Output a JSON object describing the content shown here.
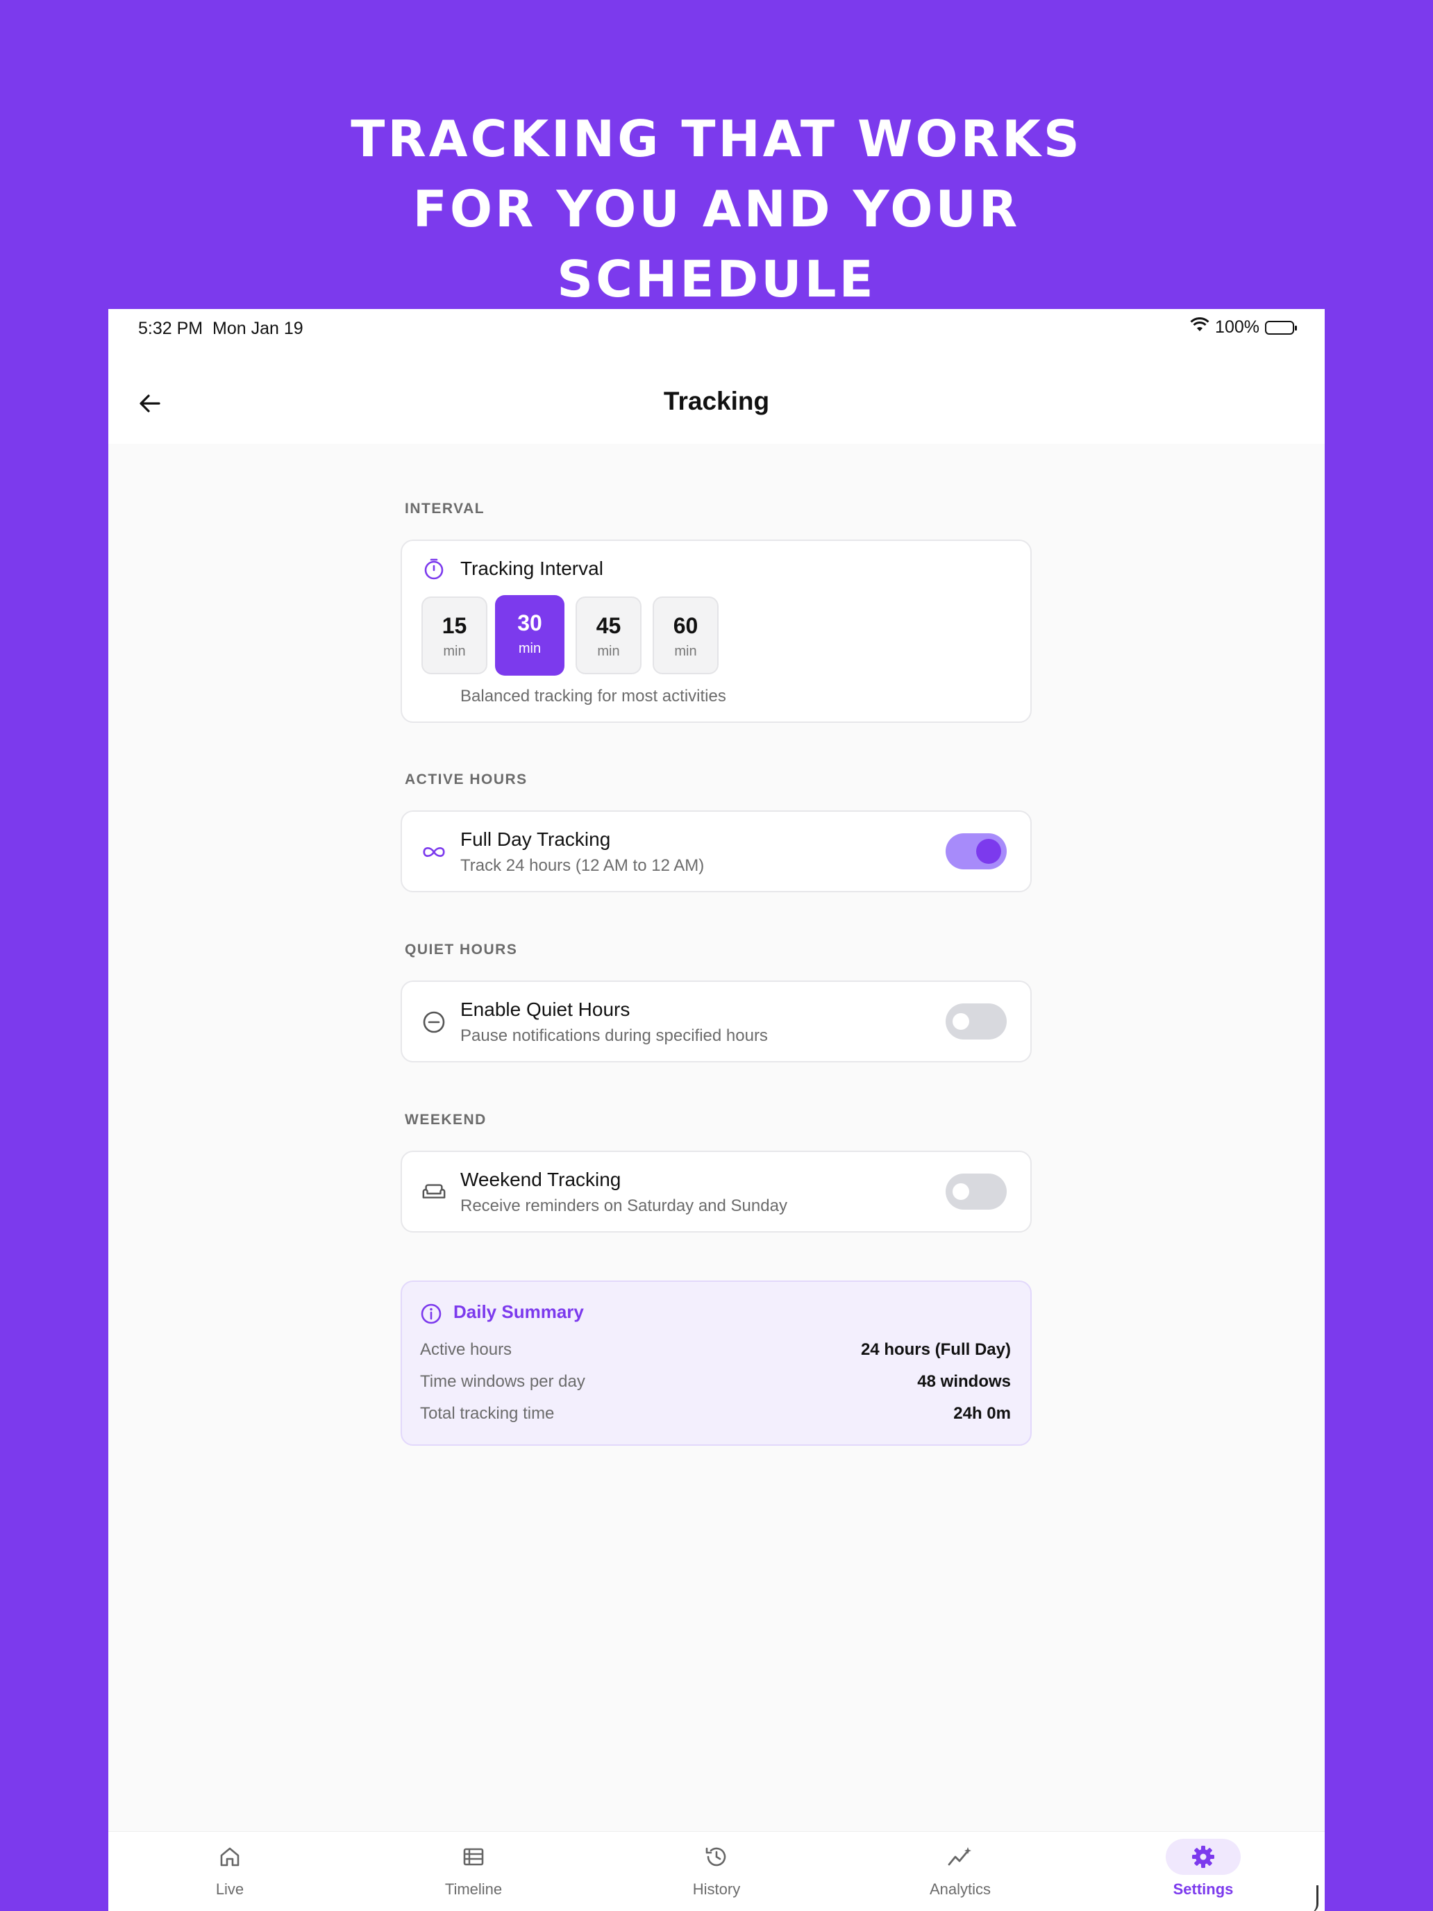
{
  "headline": [
    "TRACKING THAT WORKS",
    "FOR YOU AND YOUR",
    "SCHEDULE"
  ],
  "status_bar": {
    "time": "5:32 PM",
    "date": "Mon Jan 19",
    "battery": "100%"
  },
  "nav": {
    "title": "Tracking"
  },
  "interval": {
    "section_label": "INTERVAL",
    "title": "Tracking Interval",
    "options": [
      {
        "value": "15",
        "unit": "min"
      },
      {
        "value": "30",
        "unit": "min"
      },
      {
        "value": "45",
        "unit": "min"
      },
      {
        "value": "60",
        "unit": "min"
      }
    ],
    "selected": "30",
    "description": "Balanced tracking for most activities"
  },
  "active_hours": {
    "section_label": "ACTIVE HOURS",
    "title": "Full Day Tracking",
    "subtitle": "Track 24 hours (12 AM to 12 AM)",
    "enabled": true
  },
  "quiet_hours": {
    "section_label": "QUIET HOURS",
    "title": "Enable Quiet Hours",
    "subtitle": "Pause notifications during specified hours",
    "enabled": false
  },
  "weekend": {
    "section_label": "WEEKEND",
    "title": "Weekend Tracking",
    "subtitle": "Receive reminders on Saturday and Sunday",
    "enabled": false
  },
  "summary": {
    "title": "Daily Summary",
    "rows": [
      {
        "label": "Active hours",
        "value": "24 hours (Full Day)"
      },
      {
        "label": "Time windows per day",
        "value": "48 windows"
      },
      {
        "label": "Total tracking time",
        "value": "24h 0m"
      }
    ]
  },
  "tabs": [
    {
      "label": "Live",
      "icon": "home-icon"
    },
    {
      "label": "Timeline",
      "icon": "list-icon"
    },
    {
      "label": "History",
      "icon": "history-icon"
    },
    {
      "label": "Analytics",
      "icon": "analytics-icon"
    },
    {
      "label": "Settings",
      "icon": "gear-icon"
    }
  ],
  "active_tab": "Settings",
  "colors": {
    "accent": "#7c3aed",
    "accent_light": "#a78bfa",
    "background": "#fafafa"
  }
}
